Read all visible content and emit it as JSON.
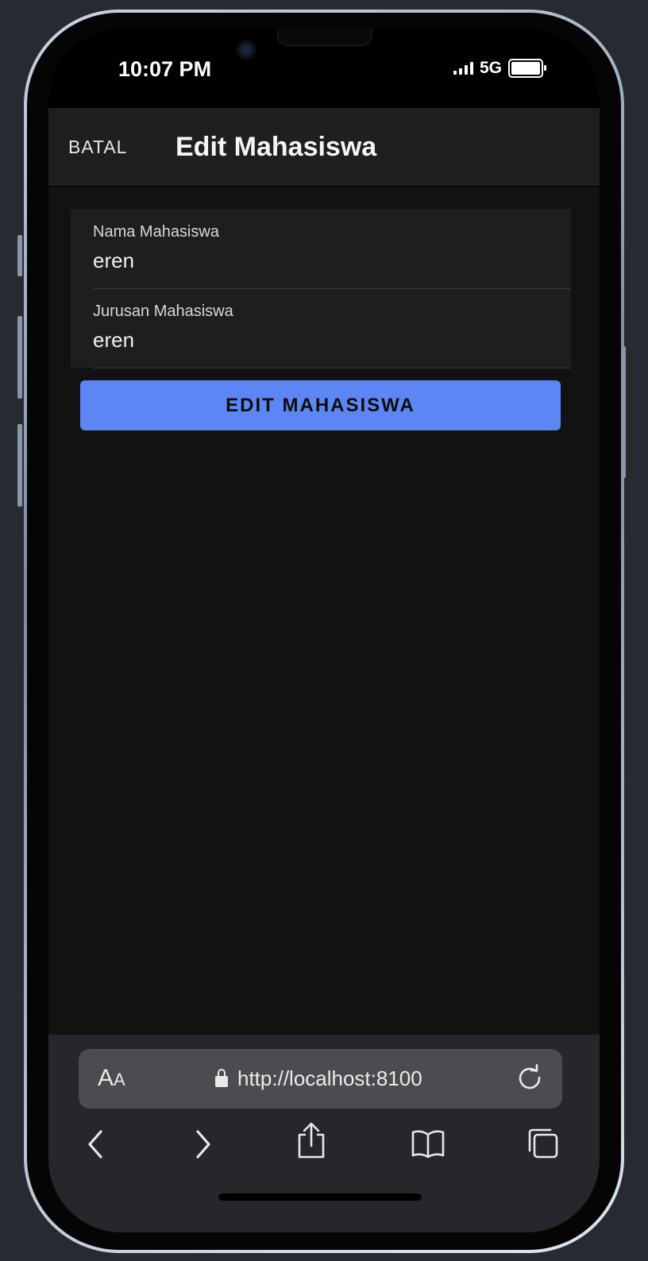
{
  "status_bar": {
    "time": "10:07 PM",
    "network": "5G"
  },
  "header": {
    "cancel_label": "BATAL",
    "title": "Edit Mahasiswa"
  },
  "form": {
    "fields": [
      {
        "label": "Nama Mahasiswa",
        "value": "eren"
      },
      {
        "label": "Jurusan Mahasiswa",
        "value": "eren"
      }
    ],
    "submit_label": "EDIT MAHASISWA"
  },
  "browser": {
    "text_size_label": "A",
    "text_size_small": "A",
    "url": "http://localhost:8100",
    "nav_icons": [
      "back-icon",
      "forward-icon",
      "share-icon",
      "bookmarks-icon",
      "tabs-icon"
    ]
  },
  "colors": {
    "accent": "#5b86f4",
    "header_bg": "#1f1f1f",
    "content_bg": "#121212",
    "card_bg": "#1e1e1e"
  }
}
